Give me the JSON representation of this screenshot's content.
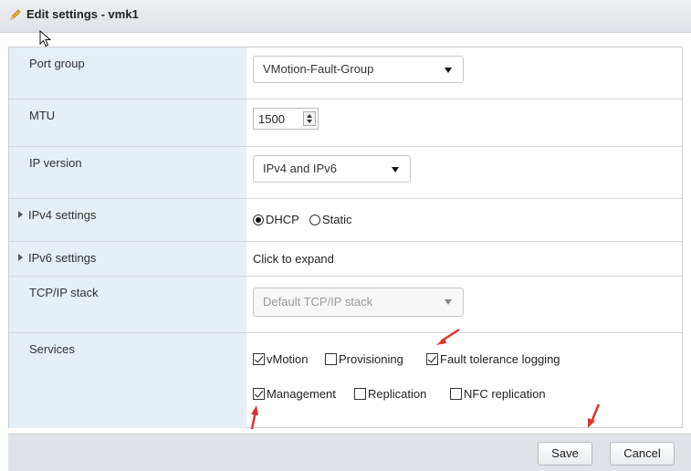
{
  "dialog": {
    "title": "Edit settings - vmk1"
  },
  "fields": {
    "port_group": {
      "label": "Port group",
      "value": "VMotion-Fault-Group"
    },
    "mtu": {
      "label": "MTU",
      "value": "1500"
    },
    "ip_version": {
      "label": "IP version",
      "value": "IPv4 and IPv6"
    },
    "ipv4": {
      "label": "IPv4 settings",
      "dhcp": "DHCP",
      "static": "Static",
      "selected": "DHCP"
    },
    "ipv6": {
      "label": "IPv6 settings",
      "value": "Click to expand"
    },
    "tcpip": {
      "label": "TCP/IP stack",
      "value": "Default TCP/IP stack",
      "disabled": true
    },
    "services": {
      "label": "Services",
      "items": [
        {
          "label": "vMotion",
          "checked": true
        },
        {
          "label": "Provisioning",
          "checked": false
        },
        {
          "label": "Fault tolerance logging",
          "checked": true
        },
        {
          "label": "Management",
          "checked": true
        },
        {
          "label": "Replication",
          "checked": false
        },
        {
          "label": "NFC replication",
          "checked": false
        }
      ]
    }
  },
  "footer": {
    "save_label": "Save",
    "cancel_label": "Cancel"
  },
  "colors": {
    "label_bg": "#e6eef6",
    "annotation_arrow": "#e0322a"
  },
  "icons": {
    "title": "pencil-icon",
    "pointer": "mouse-pointer-icon",
    "annotation": "red-arrow-icon"
  }
}
